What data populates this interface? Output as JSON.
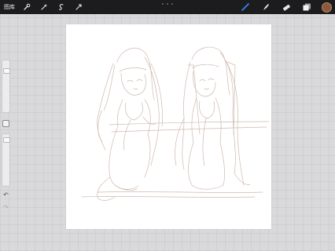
{
  "toolbar": {
    "gallery_label": "图库",
    "left_icons": [
      "wrench-icon",
      "magic-wand-icon",
      "selection-s-icon",
      "transform-arrow-icon"
    ],
    "right_icons": [
      "brush-icon",
      "smudge-icon",
      "eraser-icon",
      "layers-icon"
    ],
    "color": "#8a5a3b"
  },
  "sidebar": {
    "brush_size_level": 0.15,
    "opacity_level": 0.05,
    "undo_icon": "↶",
    "redo_icon": "↷"
  }
}
